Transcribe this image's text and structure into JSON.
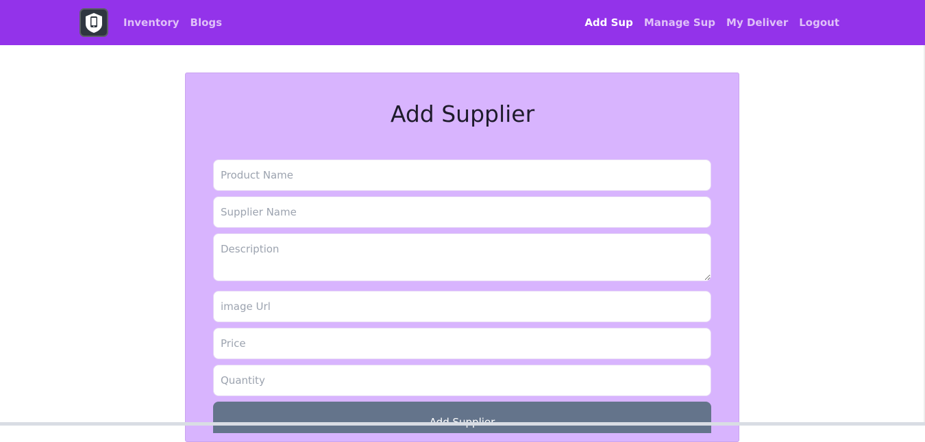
{
  "nav": {
    "left_links": [
      "Inventory",
      "Blogs"
    ],
    "right_links": [
      "Add Sup",
      "Manage Sup",
      "My Deliver",
      "Logout"
    ],
    "active": "Add Sup",
    "logo_icon": "phone-shield-icon"
  },
  "form": {
    "title": "Add Supplier",
    "fields": {
      "product_name": "Product Name",
      "supplier_name": "Supplier Name",
      "description": "Description",
      "image_url": "image Url",
      "price": "Price",
      "quantity": "Quantity"
    },
    "submit_label": "Add Supplier"
  },
  "colors": {
    "navbar": "#9333ea",
    "card": "#d8b4fe",
    "button": "#64748b"
  }
}
